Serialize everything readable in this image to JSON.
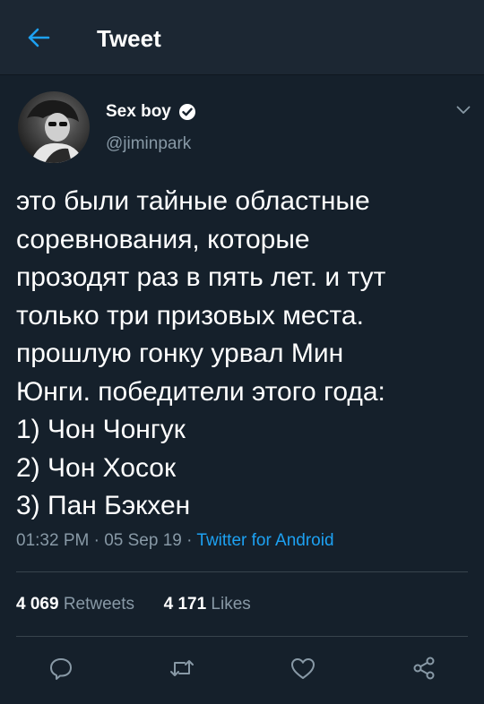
{
  "header": {
    "title": "Tweet"
  },
  "tweet": {
    "author_name": "Sex boy",
    "author_handle": "@jiminpark",
    "lines": [
      "это были тайные областные",
      "соревнования, которые",
      "прозодят раз в пять лет. и тут",
      "только три призовых места.",
      "прошлую гонку урвал Мин",
      "Юнги. победители этого года:",
      "1) Чон Чонгук",
      "2) Чон Хосок",
      "3) Пан Бэкхен"
    ],
    "time": "01:32 PM",
    "date": "05 Sep 19",
    "separator": "·",
    "source": "Twitter for Android"
  },
  "stats": {
    "retweets_count": "4 069",
    "retweets_label": "Retweets",
    "likes_count": "4 171",
    "likes_label": "Likes"
  },
  "colors": {
    "background": "#15202b",
    "header_bg": "#1c2733",
    "secondary_text": "#8899a6",
    "accent": "#1da1f2",
    "divider": "#38444d"
  },
  "icons": {
    "back": "arrow-left-icon",
    "verified": "verified-badge-icon",
    "menu": "chevron-down-icon",
    "reply": "reply-icon",
    "retweet": "retweet-icon",
    "like": "heart-icon",
    "share": "share-icon"
  }
}
